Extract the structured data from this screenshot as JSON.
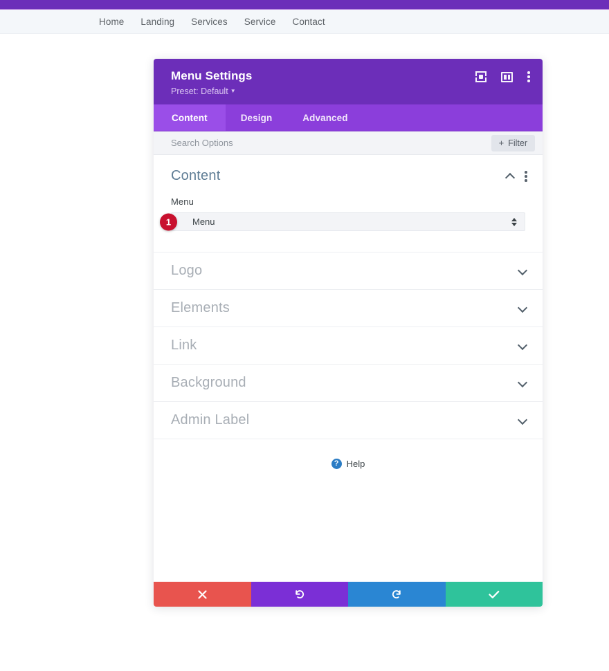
{
  "site_nav": {
    "items": [
      {
        "label": "Home"
      },
      {
        "label": "Landing"
      },
      {
        "label": "Services"
      },
      {
        "label": "Service"
      },
      {
        "label": "Contact"
      }
    ]
  },
  "modal": {
    "title": "Menu Settings",
    "preset_label": "Preset: Default",
    "header_icons": [
      {
        "name": "focus-icon"
      },
      {
        "name": "layout-icon"
      },
      {
        "name": "kebab-menu-icon"
      }
    ],
    "tabs": [
      {
        "label": "Content",
        "active": true
      },
      {
        "label": "Design",
        "active": false
      },
      {
        "label": "Advanced",
        "active": false
      }
    ],
    "search": {
      "placeholder": "Search Options",
      "value": ""
    },
    "filter_button": {
      "label": "Filter",
      "plus": "+"
    },
    "content_section": {
      "title": "Content",
      "expanded": true,
      "field": {
        "label": "Menu",
        "value": "Menu",
        "badge": "1"
      }
    },
    "collapsed_sections": [
      {
        "label": "Logo"
      },
      {
        "label": "Elements"
      },
      {
        "label": "Link"
      },
      {
        "label": "Background"
      },
      {
        "label": "Admin Label"
      }
    ],
    "help": {
      "label": "Help",
      "icon_glyph": "?"
    },
    "actions": [
      {
        "name": "cancel-button",
        "glyph": "✕",
        "color": "#e8544e"
      },
      {
        "name": "undo-button",
        "glyph": "↺",
        "color": "#7b2fd6"
      },
      {
        "name": "redo-button",
        "glyph": "↻",
        "color": "#2a86d3"
      },
      {
        "name": "save-button",
        "glyph": "✓",
        "color": "#2fc39b"
      }
    ]
  },
  "colors": {
    "header_purple": "#6c2eb9",
    "tabbar_purple": "#8b3edb",
    "tab_active_purple": "#9a4ee8",
    "badge_red": "#c8102e",
    "help_blue": "#2b7cc4",
    "section_title_blue": "#5f7d95"
  }
}
